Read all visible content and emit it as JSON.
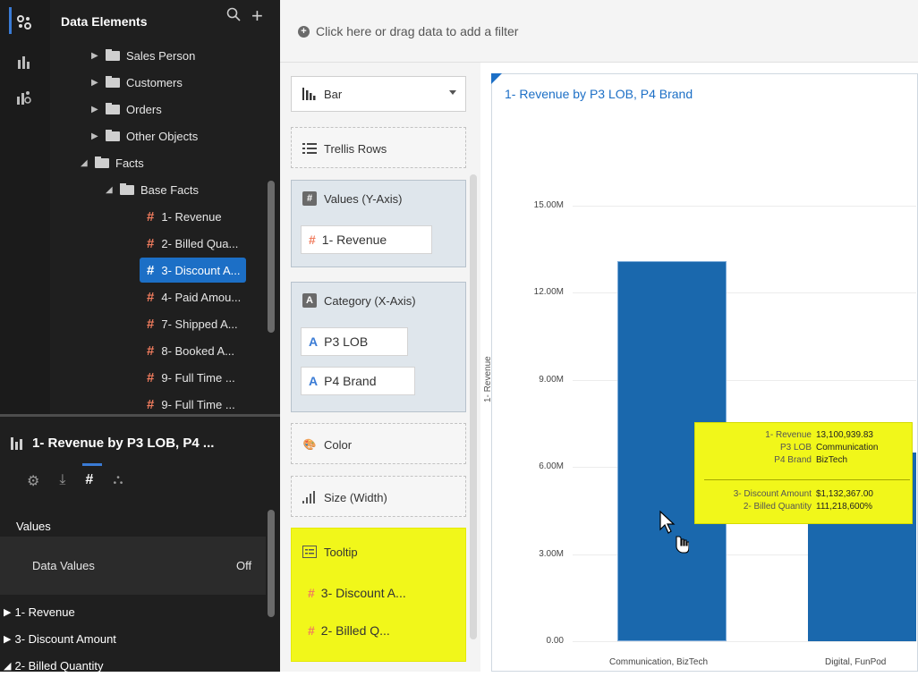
{
  "left_panel": {
    "title": "Data Elements",
    "tree": [
      {
        "label": "Sales Person",
        "kind": "folder",
        "toggle": "▶"
      },
      {
        "label": "Customers",
        "kind": "folder",
        "toggle": "▶"
      },
      {
        "label": "Orders",
        "kind": "folder",
        "toggle": "▶"
      },
      {
        "label": "Other Objects",
        "kind": "folder",
        "toggle": "▶"
      },
      {
        "label": "Facts",
        "kind": "folder",
        "toggle": "◢"
      },
      {
        "label": "Base Facts",
        "kind": "folder",
        "toggle": "◢"
      },
      {
        "label": "1- Revenue",
        "kind": "measure"
      },
      {
        "label": "2- Billed Qua...",
        "kind": "measure"
      },
      {
        "label": "3- Discount A...",
        "kind": "measure",
        "selected": true
      },
      {
        "label": "4- Paid Amou...",
        "kind": "measure"
      },
      {
        "label": "7- Shipped A...",
        "kind": "measure"
      },
      {
        "label": "8- Booked A...",
        "kind": "measure"
      },
      {
        "label": "9- Full Time ...",
        "kind": "measure"
      },
      {
        "label": "9- Full Time ...",
        "kind": "measure"
      }
    ],
    "viz_title": "1- Revenue by P3 LOB, P4 ...",
    "values_heading": "Values",
    "data_values_label": "Data Values",
    "data_values_value": "Off",
    "measures": [
      {
        "label": "1- Revenue",
        "toggle": "▶"
      },
      {
        "label": "3- Discount Amount",
        "toggle": "▶"
      },
      {
        "label": "2- Billed Quantity",
        "toggle": "◢"
      }
    ]
  },
  "filter_bar": {
    "text": "Click here or drag data to add a filter"
  },
  "grammar": {
    "chart_type": "Bar",
    "trellis_rows": "Trellis Rows",
    "values_label": "Values (Y-Axis)",
    "values_items": [
      "1- Revenue"
    ],
    "category_label": "Category (X-Axis)",
    "category_items": [
      "P3 LOB",
      "P4 Brand"
    ],
    "color_label": "Color",
    "size_label": "Size (Width)",
    "tooltip_label": "Tooltip",
    "tooltip_items": [
      "3- Discount A...",
      "2- Billed Q..."
    ]
  },
  "chart_data": {
    "type": "bar",
    "title": "1- Revenue by P3 LOB, P4 Brand",
    "ylabel": "1- Revenue",
    "xlabel": "",
    "categories": [
      "Communication, BizTech",
      "Digital, FunPod"
    ],
    "values": [
      13100939.83,
      6500000
    ],
    "ylim": [
      0,
      15000000
    ],
    "yticks": [
      "0.00",
      "3.00M",
      "6.00M",
      "9.00M",
      "12.00M",
      "15.00M"
    ],
    "grid": true,
    "bar_color": "#1a68ad"
  },
  "tooltip": {
    "rows": [
      {
        "k": "1- Revenue",
        "v": "13,100,939.83"
      },
      {
        "k": "P3 LOB",
        "v": "Communication"
      },
      {
        "k": "P4 Brand",
        "v": "BizTech"
      },
      {
        "k": "3- Discount Amount",
        "v": "$1,132,367.00"
      },
      {
        "k": "2- Billed Quantity",
        "v": "111,218,600%"
      }
    ]
  },
  "colors": {
    "accent": "#1c6fc6",
    "measure": "#f07c5e",
    "highlight": "#f1f71a"
  }
}
